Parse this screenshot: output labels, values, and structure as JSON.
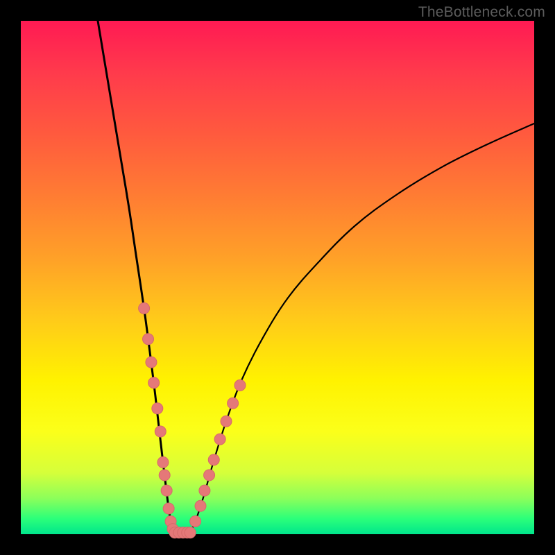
{
  "watermark": "TheBottleneck.com",
  "chart_data": {
    "type": "line",
    "title": "",
    "xlabel": "",
    "ylabel": "",
    "xlim": [
      0,
      100
    ],
    "ylim": [
      0,
      100
    ],
    "curve_left": {
      "x": [
        15,
        17,
        19,
        21,
        22.5,
        24,
        25.2,
        26.2,
        27,
        27.7,
        28.3,
        28.8,
        29.2,
        29.6,
        30
      ],
      "y": [
        100,
        88,
        76,
        64,
        54,
        44,
        35,
        27,
        20,
        14,
        9,
        5,
        2.5,
        1,
        0.3
      ]
    },
    "curve_right": {
      "x": [
        33,
        34,
        35.5,
        37.5,
        40,
        43,
        47,
        52,
        58,
        65,
        73,
        82,
        91,
        100
      ],
      "y": [
        0.3,
        2.5,
        7,
        14,
        22,
        30,
        38,
        46,
        53,
        60,
        66,
        71.5,
        76,
        80
      ]
    },
    "flat_min": {
      "x": [
        30,
        33
      ],
      "y": [
        0.3,
        0.3
      ]
    },
    "markers_left": {
      "x": [
        24.0,
        24.8,
        25.4,
        25.9,
        26.6,
        27.2,
        27.7,
        28.0,
        28.4,
        28.8,
        29.2,
        29.6
      ],
      "y": [
        44.0,
        38.0,
        33.5,
        29.5,
        24.5,
        20.0,
        14.0,
        11.5,
        8.5,
        5.0,
        2.5,
        1.0
      ]
    },
    "markers_right": {
      "x": [
        34.0,
        35.0,
        35.8,
        36.7,
        37.6,
        38.8,
        40.0,
        41.3,
        42.7
      ],
      "y": [
        2.5,
        5.5,
        8.5,
        11.5,
        14.5,
        18.5,
        22.0,
        25.5,
        29.0
      ]
    },
    "markers_bottom": {
      "x": [
        30.0,
        30.8,
        31.6,
        32.4,
        33.0
      ],
      "y": [
        0.3,
        0.3,
        0.3,
        0.3,
        0.3
      ]
    },
    "colors": {
      "curve": "#000000",
      "marker_fill": "#e57878",
      "marker_stroke": "#d66a6a"
    }
  }
}
